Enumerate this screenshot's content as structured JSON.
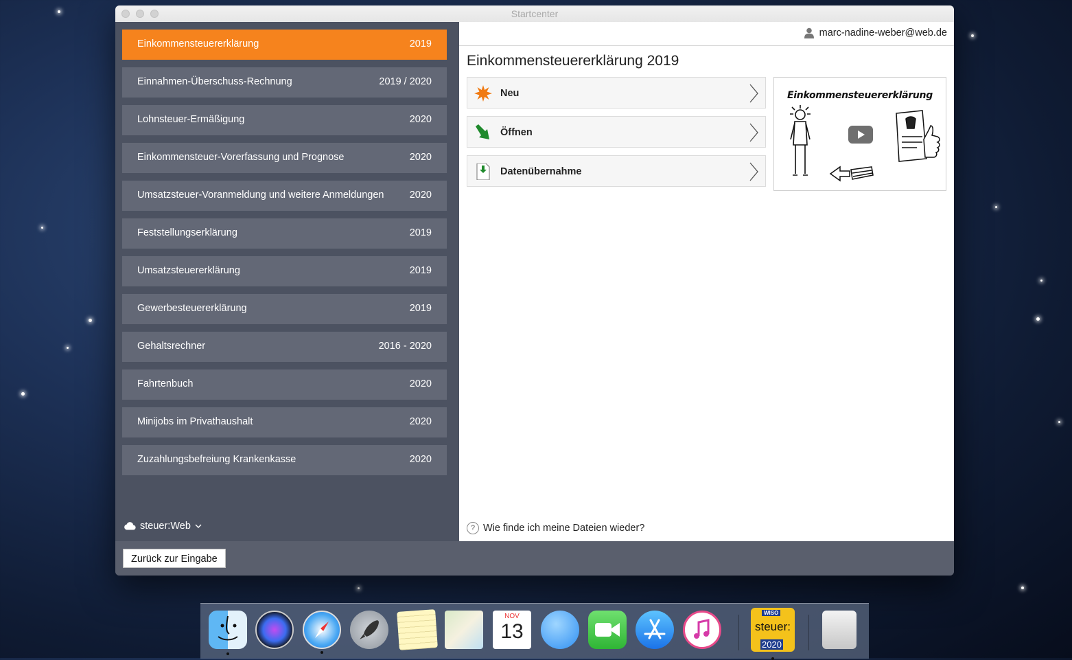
{
  "window": {
    "title": "Startcenter"
  },
  "sidebar": {
    "items": [
      {
        "label": "Einkommensteuererklärung",
        "year": "2019"
      },
      {
        "label": "Einnahmen-Überschuss-Rechnung",
        "year": "2019 / 2020"
      },
      {
        "label": "Lohnsteuer-Ermäßigung",
        "year": "2020"
      },
      {
        "label": "Einkommensteuer-Vorerfassung und Prognose",
        "year": "2020"
      },
      {
        "label": "Umsatzsteuer-Voranmeldung und weitere Anmeldungen",
        "year": "2020"
      },
      {
        "label": "Feststellungserklärung",
        "year": "2019"
      },
      {
        "label": "Umsatzsteuererklärung",
        "year": "2019"
      },
      {
        "label": "Gewerbesteuererklärung",
        "year": "2019"
      },
      {
        "label": "Gehaltsrechner",
        "year": "2016 - 2020"
      },
      {
        "label": "Fahrtenbuch",
        "year": "2020"
      },
      {
        "label": "Minijobs im Privathaushalt",
        "year": "2020"
      },
      {
        "label": "Zuzahlungsbefreiung Krankenkasse",
        "year": "2020"
      }
    ],
    "active_index": 0,
    "storage_selector": "steuer:Web"
  },
  "main": {
    "user_email": "marc-nadine-weber@web.de",
    "page_title": "Einkommensteuererklärung 2019",
    "actions": {
      "new": "Neu",
      "open": "Öffnen",
      "import": "Datenübernahme"
    },
    "video_title": "Einkommensteuererklärung",
    "help_link": "Wie finde ich meine Dateien wieder?"
  },
  "footer": {
    "back_button": "Zurück zur Eingabe"
  },
  "dock": {
    "items": [
      "Finder",
      "Siri",
      "Safari",
      "Launchpad",
      "Notizen",
      "Karten",
      "Kalender",
      "Nachrichten",
      "FaceTime",
      "App Store",
      "iTunes",
      "WISO steuer: 2020",
      "Papierkorb"
    ],
    "calendar_month": "NOV",
    "calendar_day": "13",
    "wiso_brand": "WISO",
    "wiso_name": "steuer:",
    "wiso_year": "2020"
  },
  "colors": {
    "accent": "#f6831d",
    "sidebar_bg": "#4c5261",
    "nav_item_bg": "#636876"
  }
}
